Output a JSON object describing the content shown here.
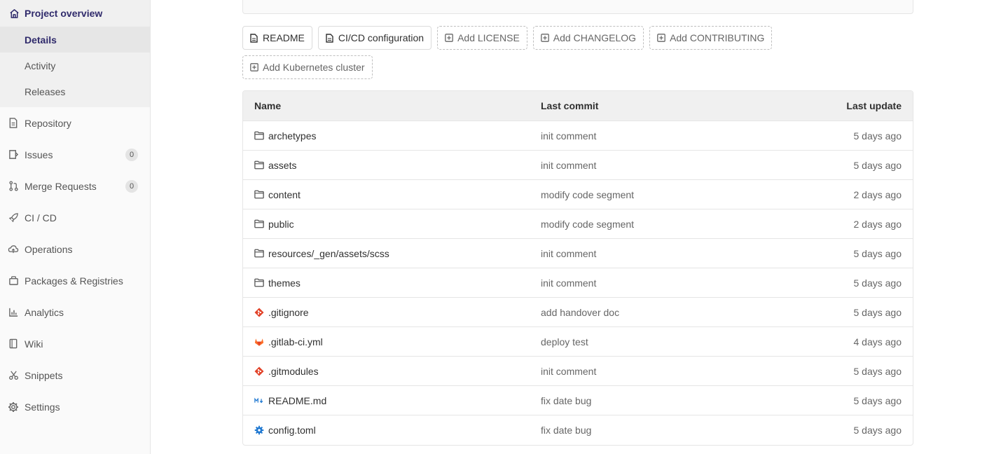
{
  "sidebar": {
    "header": {
      "label": "Project overview",
      "icon": "home-icon"
    },
    "subitems": [
      {
        "label": "Details",
        "active": true
      },
      {
        "label": "Activity",
        "active": false
      },
      {
        "label": "Releases",
        "active": false
      }
    ],
    "items": [
      {
        "label": "Repository",
        "icon": "doc-icon"
      },
      {
        "label": "Issues",
        "icon": "issues-icon",
        "badge": "0"
      },
      {
        "label": "Merge Requests",
        "icon": "merge-icon",
        "badge": "0"
      },
      {
        "label": "CI / CD",
        "icon": "rocket-icon"
      },
      {
        "label": "Operations",
        "icon": "cloud-icon"
      },
      {
        "label": "Packages & Registries",
        "icon": "package-icon"
      },
      {
        "label": "Analytics",
        "icon": "chart-icon"
      },
      {
        "label": "Wiki",
        "icon": "book-icon"
      },
      {
        "label": "Snippets",
        "icon": "scissors-icon"
      },
      {
        "label": "Settings",
        "icon": "gear-icon"
      }
    ]
  },
  "quick_buttons": [
    {
      "label": "README",
      "dashed": false,
      "icon": "file-icon"
    },
    {
      "label": "CI/CD configuration",
      "dashed": false,
      "icon": "file-icon"
    },
    {
      "label": "Add LICENSE",
      "dashed": true,
      "icon": "plus-square-icon"
    },
    {
      "label": "Add CHANGELOG",
      "dashed": true,
      "icon": "plus-square-icon"
    },
    {
      "label": "Add CONTRIBUTING",
      "dashed": true,
      "icon": "plus-square-icon"
    }
  ],
  "quick_buttons_row2": [
    {
      "label": "Add Kubernetes cluster",
      "dashed": true,
      "icon": "plus-square-icon"
    }
  ],
  "table": {
    "headers": {
      "name": "Name",
      "commit": "Last commit",
      "update": "Last update"
    },
    "rows": [
      {
        "name": "archetypes",
        "type": "folder",
        "commit": "init comment",
        "update": "5 days ago"
      },
      {
        "name": "assets",
        "type": "folder",
        "commit": "init comment",
        "update": "5 days ago"
      },
      {
        "name": "content",
        "type": "folder",
        "commit": "modify code segment",
        "update": "2 days ago"
      },
      {
        "name": "public",
        "type": "folder",
        "commit": "modify code segment",
        "update": "2 days ago"
      },
      {
        "name": "resources/_gen/assets/scss",
        "type": "folder",
        "commit": "init comment",
        "update": "5 days ago"
      },
      {
        "name": "themes",
        "type": "folder",
        "commit": "init comment",
        "update": "5 days ago"
      },
      {
        "name": ".gitignore",
        "type": "git",
        "commit": "add handover doc",
        "update": "5 days ago"
      },
      {
        "name": ".gitlab-ci.yml",
        "type": "gitlab",
        "commit": "deploy test",
        "update": "4 days ago"
      },
      {
        "name": ".gitmodules",
        "type": "git",
        "commit": "init comment",
        "update": "5 days ago"
      },
      {
        "name": "README.md",
        "type": "markdown",
        "commit": "fix date bug",
        "update": "5 days ago"
      },
      {
        "name": "config.toml",
        "type": "config",
        "commit": "fix date bug",
        "update": "5 days ago"
      }
    ]
  },
  "colors": {
    "accent": "#2f2a6b",
    "git": "#e24329",
    "gitlab": "#fc6d26",
    "markdown": "#1f78d1",
    "config": "#1f78d1"
  }
}
